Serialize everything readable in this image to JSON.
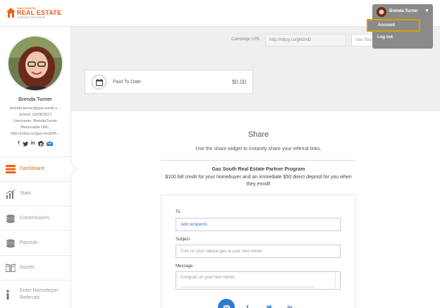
{
  "brand": {
    "top_text": "GAS SOUTH",
    "main_text": "REAL ESTATE",
    "sub_text": "PARTNER PROGRAM",
    "color": "#e8601c"
  },
  "user_menu": {
    "name": "Brenda Turner",
    "items": [
      "Account",
      "Log out"
    ],
    "selected": "Account",
    "icon": "chevron-down-icon"
  },
  "profile": {
    "name": "Brenda Turner",
    "email": "brenda.turner@gas-south.c...",
    "joined": "Joined: 02/06/2017",
    "username": "Username: BrendaTurner",
    "memorable_label": "Memorable URL:",
    "memorable_url": "http://mbsy.co/gas-south/B...",
    "social_icons": [
      "facebook-icon",
      "twitter-icon",
      "linkedin-icon",
      "pinterest-icon",
      "email-icon"
    ]
  },
  "nav": [
    {
      "label": "Dashboard",
      "icon": "dashboard-icon",
      "active": true
    },
    {
      "label": "Stats",
      "icon": "stats-icon",
      "active": false
    },
    {
      "label": "Commissions",
      "icon": "commissions-icon",
      "active": false
    },
    {
      "label": "Payouts",
      "icon": "payouts-icon",
      "active": false
    },
    {
      "label": "Assets",
      "icon": "assets-icon",
      "active": false
    },
    {
      "label": "Enter Homebuyer Referrals",
      "icon": "info-icon",
      "active": false
    }
  ],
  "campaign": {
    "label": "Campaign URL",
    "url": "http://mbsy.co/gMzmD",
    "button": "Gas Sou..."
  },
  "paid": {
    "label": "Paid To Date",
    "value": "$0.00",
    "icon": "calendar-icon"
  },
  "share": {
    "title": "Share",
    "subtitle": "Use the share widget to instantly share your referral links.",
    "program_title": "Gas South Real Estate Partner Program",
    "program_desc": "$100 bill credit for your homebuyer and an immediate $50 direct deposit for you when they enroll!",
    "to_label": "To",
    "to_placeholder": "Add recipients",
    "subject_label": "Subject",
    "subject_value": "Turn on your natural gas at your new home!",
    "message_label": "Message",
    "message_value": "Congrats on your new home!",
    "share_icons": [
      "email-icon",
      "facebook-icon",
      "twitter-icon",
      "linkedin-icon"
    ]
  },
  "colors": {
    "accent": "#e8601c",
    "email_circle": "#2f7bd0",
    "menu_bg": "#8a8a8a",
    "highlight": "#d4a00a"
  }
}
